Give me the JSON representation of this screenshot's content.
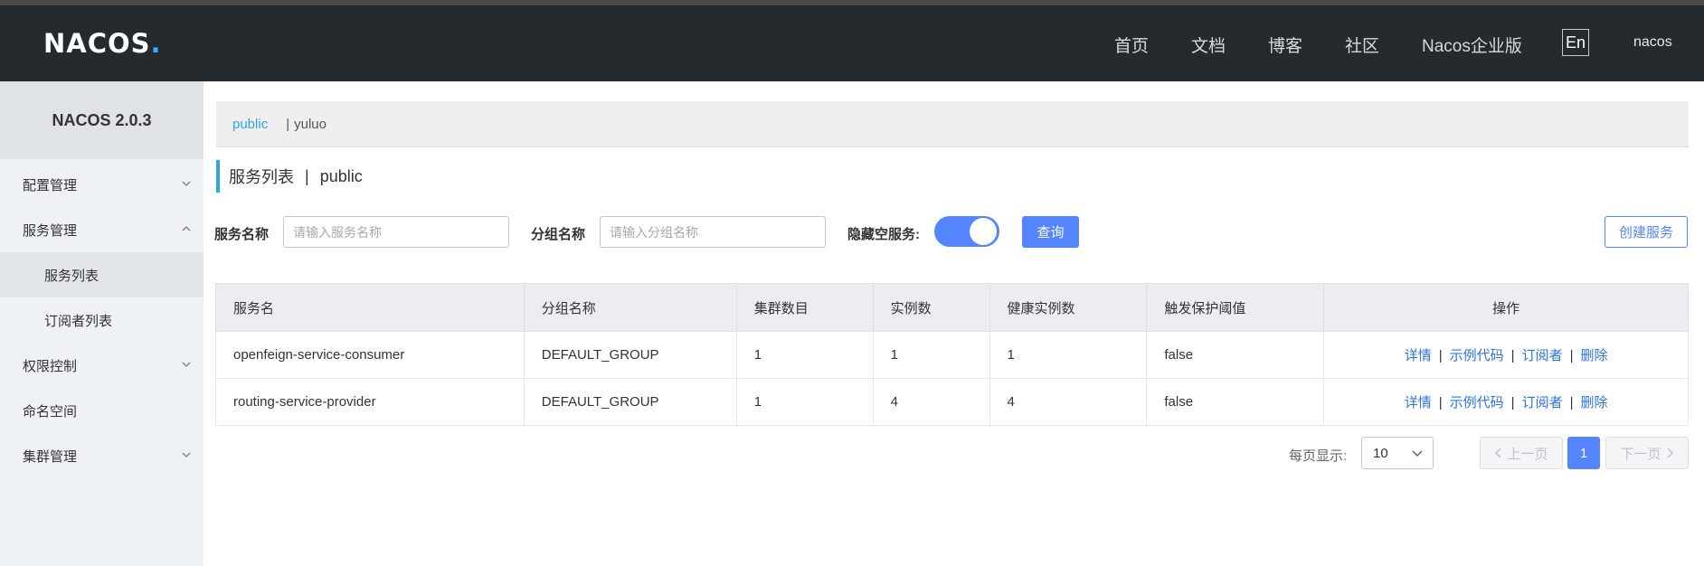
{
  "header": {
    "logo_text": "NACOS",
    "logo_dot": ".",
    "nav": [
      "首页",
      "文档",
      "博客",
      "社区",
      "Nacos企业版"
    ],
    "lang": "En",
    "user": "nacos"
  },
  "sidebar": {
    "title": "NACOS 2.0.3",
    "items": [
      {
        "label": "配置管理",
        "chevron": "down"
      },
      {
        "label": "服务管理",
        "chevron": "up"
      },
      {
        "label": "服务列表"
      },
      {
        "label": "订阅者列表"
      },
      {
        "label": "权限控制",
        "chevron": "down"
      },
      {
        "label": "命名空间"
      },
      {
        "label": "集群管理",
        "chevron": "down"
      }
    ]
  },
  "namespace": {
    "active": "public",
    "separator": "|",
    "other": "yuluo"
  },
  "page": {
    "title": "服务列表",
    "separator": "|",
    "namespace": "public"
  },
  "search": {
    "service_label": "服务名称",
    "service_placeholder": "请输入服务名称",
    "group_label": "分组名称",
    "group_placeholder": "请输入分组名称",
    "hide_empty_label": "隐藏空服务:",
    "hide_empty_on": true,
    "query_button": "查询",
    "create_button": "创建服务"
  },
  "table": {
    "headers": [
      "服务名",
      "分组名称",
      "集群数目",
      "实例数",
      "健康实例数",
      "触发保护阈值",
      "操作"
    ],
    "rows": [
      {
        "name": "openfeign-service-consumer",
        "group": "DEFAULT_GROUP",
        "clusters": "1",
        "instances": "1",
        "healthy": "1",
        "threshold": "false"
      },
      {
        "name": "routing-service-provider",
        "group": "DEFAULT_GROUP",
        "clusters": "1",
        "instances": "4",
        "healthy": "4",
        "threshold": "false"
      }
    ],
    "actions": [
      "详情",
      "示例代码",
      "订阅者",
      "删除"
    ],
    "action_separator": "|"
  },
  "pagination": {
    "page_size_label": "每页显示:",
    "page_size": "10",
    "prev": "上一页",
    "current": "1",
    "next": "下一页"
  }
}
